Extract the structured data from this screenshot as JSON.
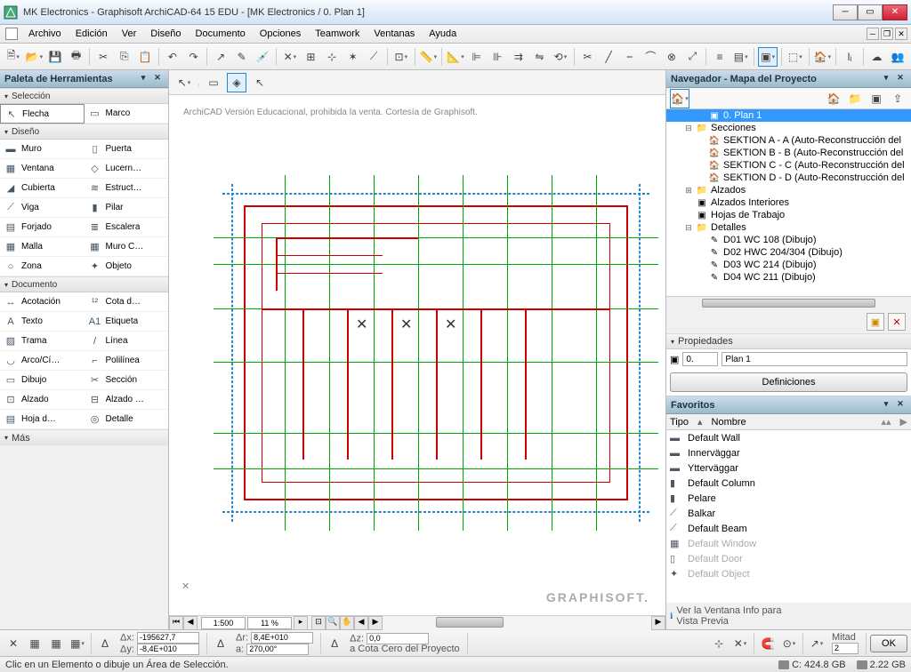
{
  "titlebar": {
    "title": "MK Electronics - Graphisoft ArchiCAD-64 15 EDU - [MK Electronics / 0. Plan 1]"
  },
  "menu": {
    "items": [
      "Archivo",
      "Edición",
      "Ver",
      "Diseño",
      "Documento",
      "Opciones",
      "Teamwork",
      "Ventanas",
      "Ayuda"
    ]
  },
  "toolbox": {
    "title": "Paleta de Herramientas",
    "sections": [
      {
        "name": "Selección",
        "tools": [
          {
            "icon": "↖",
            "label": "Flecha"
          },
          {
            "icon": "▭",
            "label": "Marco"
          }
        ]
      },
      {
        "name": "Diseño",
        "tools": [
          {
            "icon": "▬",
            "label": "Muro"
          },
          {
            "icon": "▯",
            "label": "Puerta"
          },
          {
            "icon": "▦",
            "label": "Ventana"
          },
          {
            "icon": "◇",
            "label": "Lucern…"
          },
          {
            "icon": "◢",
            "label": "Cubierta"
          },
          {
            "icon": "≋",
            "label": "Estruct…"
          },
          {
            "icon": "⟋",
            "label": "Viga"
          },
          {
            "icon": "▮",
            "label": "Pilar"
          },
          {
            "icon": "▤",
            "label": "Forjado"
          },
          {
            "icon": "≣",
            "label": "Escalera"
          },
          {
            "icon": "▦",
            "label": "Malla"
          },
          {
            "icon": "▦",
            "label": "Muro C…"
          },
          {
            "icon": "○",
            "label": "Zona"
          },
          {
            "icon": "✦",
            "label": "Objeto"
          }
        ]
      },
      {
        "name": "Documento",
        "tools": [
          {
            "icon": "↔",
            "label": "Acotación"
          },
          {
            "icon": "¹²",
            "label": "Cota d…"
          },
          {
            "icon": "A",
            "label": "Texto"
          },
          {
            "icon": "A1",
            "label": "Etiqueta"
          },
          {
            "icon": "▨",
            "label": "Trama"
          },
          {
            "icon": "/",
            "label": "Línea"
          },
          {
            "icon": "◡",
            "label": "Arco/Cí…"
          },
          {
            "icon": "⌐",
            "label": "Polilínea"
          },
          {
            "icon": "▭",
            "label": "Dibujo"
          },
          {
            "icon": "✂",
            "label": "Sección"
          },
          {
            "icon": "⊡",
            "label": "Alzado"
          },
          {
            "icon": "⊟",
            "label": "Alzado …"
          },
          {
            "icon": "▤",
            "label": "Hoja d…"
          },
          {
            "icon": "◎",
            "label": "Detalle"
          }
        ]
      }
    ],
    "more": "Más"
  },
  "canvas": {
    "watermark": "ArchiCAD Versión Educacional, prohibida la venta. Cortesía de Graphisoft.",
    "logo": "GRAPHISOFT.",
    "zoom": {
      "pct": "11 %",
      "scale": "1:500"
    }
  },
  "navigator": {
    "title": "Navegador - Mapa del Proyecto",
    "tree": [
      {
        "d": 2,
        "exp": "",
        "icon": "▣",
        "label": "0. Plan 1",
        "sel": true
      },
      {
        "d": 1,
        "exp": "⊟",
        "icon": "📁",
        "label": "Secciones"
      },
      {
        "d": 2,
        "exp": "",
        "icon": "🏠",
        "label": "SEKTION A - A (Auto-Reconstrucción del"
      },
      {
        "d": 2,
        "exp": "",
        "icon": "🏠",
        "label": "SEKTION B - B (Auto-Reconstrucción del"
      },
      {
        "d": 2,
        "exp": "",
        "icon": "🏠",
        "label": "SEKTION C - C (Auto-Reconstrucción del"
      },
      {
        "d": 2,
        "exp": "",
        "icon": "🏠",
        "label": "SEKTION D - D (Auto-Reconstrucción del"
      },
      {
        "d": 1,
        "exp": "⊞",
        "icon": "📁",
        "label": "Alzados"
      },
      {
        "d": 1,
        "exp": "",
        "icon": "▣",
        "label": "Alzados Interiores"
      },
      {
        "d": 1,
        "exp": "",
        "icon": "▣",
        "label": "Hojas de Trabajo"
      },
      {
        "d": 1,
        "exp": "⊟",
        "icon": "📁",
        "label": "Detalles"
      },
      {
        "d": 2,
        "exp": "",
        "icon": "✎",
        "label": "D01 WC 108 (Dibujo)"
      },
      {
        "d": 2,
        "exp": "",
        "icon": "✎",
        "label": "D02 HWC 204/304 (Dibujo)"
      },
      {
        "d": 2,
        "exp": "",
        "icon": "✎",
        "label": "D03 WC 214 (Dibujo)"
      },
      {
        "d": 2,
        "exp": "",
        "icon": "✎",
        "label": "D04 WC 211 (Dibujo)"
      }
    ]
  },
  "properties": {
    "title": "Propiedades",
    "id_prefix": "0.",
    "name": "Plan 1",
    "def_btn": "Definiciones"
  },
  "favorites": {
    "title": "Favoritos",
    "col_type": "Tipo",
    "col_name": "Nombre",
    "items": [
      {
        "icon": "▬",
        "name": "Default Wall"
      },
      {
        "icon": "▬",
        "name": "Innerväggar"
      },
      {
        "icon": "▬",
        "name": "Ytterväggar"
      },
      {
        "icon": "▮",
        "name": "Default Column"
      },
      {
        "icon": "▮",
        "name": "Pelare"
      },
      {
        "icon": "⟋",
        "name": "Balkar"
      },
      {
        "icon": "⟋",
        "name": "Default Beam"
      },
      {
        "icon": "▦",
        "name": "Default Window",
        "dim": true
      },
      {
        "icon": "▯",
        "name": "Default Door",
        "dim": true
      },
      {
        "icon": "✦",
        "name": "Default Object",
        "dim": true
      }
    ],
    "hint1": "Ver la Ventana Info para",
    "hint2": "Vista Previa"
  },
  "coord": {
    "dx": "Δx:",
    "dx_v": "-195627,7",
    "dy": "Δy:",
    "dy_v": "-8,4E+010",
    "dr": "Δr:",
    "dr_v": "8,4E+010",
    "a": "a:",
    "a_v": "270,00°",
    "dz": "Δz:",
    "dz_v": "0,0",
    "zref": "a Cota Cero del Proyecto",
    "mitad": "Mitad",
    "mitad_v": "2",
    "ok": "OK"
  },
  "status": {
    "hint": "Clic en un Elemento o dibuje un Área de Selección.",
    "disk_c": "C: 424.8 GB",
    "disk_d": "2.22 GB"
  }
}
